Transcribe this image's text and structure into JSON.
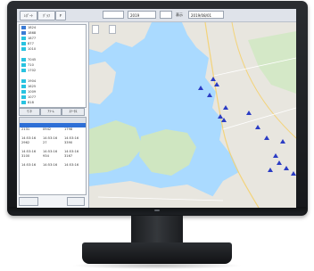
{
  "toolbar": {
    "btn1": "ﾚﾎﾟｰﾄ",
    "btn2": "ｸﾞﾗﾌ",
    "btn3": "Ｆ",
    "input1": "",
    "date": "2019",
    "label": "表示",
    "input2": "",
    "range": "2019/08/01"
  },
  "list": {
    "rows": [
      {
        "num": "1824",
        "tag": "",
        "color": "#3a7bd5"
      },
      {
        "num": "1868",
        "tag": "",
        "color": "#3a7bd5"
      },
      {
        "num": "1877",
        "tag": "",
        "color": "#29c3e0"
      },
      {
        "num": "877",
        "tag": "",
        "color": "#29c3e0"
      },
      {
        "num": "1010",
        "tag": "",
        "color": "#29c3e0"
      },
      {
        "num": "",
        "tag": "",
        "color": "#ffffff"
      },
      {
        "num": "7045",
        "tag": "",
        "color": "#29c3e0"
      },
      {
        "num": "710",
        "tag": "",
        "color": "#29c3e0"
      },
      {
        "num": "1702",
        "tag": "",
        "color": "#29c3e0"
      },
      {
        "num": "",
        "tag": "",
        "color": "#ffffff"
      },
      {
        "num": "1904",
        "tag": "",
        "color": "#29c3e0"
      },
      {
        "num": "1625",
        "tag": "",
        "color": "#29c3e0"
      },
      {
        "num": "1009",
        "tag": "",
        "color": "#29c3e0"
      },
      {
        "num": "1077",
        "tag": "",
        "color": "#29c3e0"
      },
      {
        "num": "818",
        "tag": "",
        "color": "#29c3e0"
      }
    ]
  },
  "tabs": [
    "ﾓﾆﾀ",
    "ｱﾗｰﾑ",
    "ｽﾃｰﾀｽ"
  ],
  "grid": {
    "rows": [
      {
        "a": "",
        "b": "",
        "c": "",
        "sel": true
      },
      {
        "a": "2131",
        "b": "0942",
        "c": "1798",
        "sel": false
      },
      {
        "a": "",
        "b": "",
        "c": "",
        "sel": false
      },
      {
        "a": "14:53:16",
        "b": "14:53:16",
        "c": "14:53:16",
        "sel": false
      },
      {
        "a": "2962",
        "b": "27",
        "c": "3390",
        "sel": false
      },
      {
        "a": "",
        "b": "",
        "c": "",
        "sel": false
      },
      {
        "a": "14:53:16",
        "b": "14:53:16",
        "c": "14:53:16",
        "sel": false
      },
      {
        "a": "3100",
        "b": "934",
        "c": "3167",
        "sel": false
      },
      {
        "a": "",
        "b": "",
        "c": "",
        "sel": false
      },
      {
        "a": "14:53:16",
        "b": "14:53:16",
        "c": "14:53:16",
        "sel": false
      }
    ]
  },
  "bottom": {
    "left_btn": "",
    "right_btn": ""
  },
  "map": {
    "tab1": "",
    "tab2": ""
  },
  "colors": {
    "water": "#aadaff",
    "land": "#e8e6df",
    "marker": "#2b3cc4"
  }
}
